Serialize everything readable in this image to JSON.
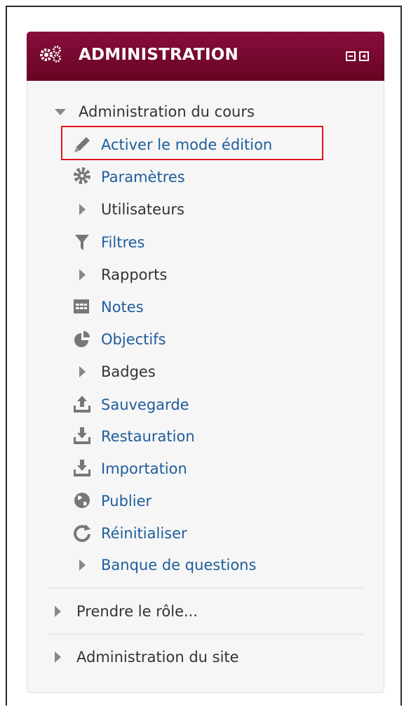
{
  "block": {
    "title": "ADMINISTRATION",
    "header_color": "#7a0a33",
    "link_color": "#1e5d9c"
  },
  "course_admin": {
    "label": "Administration du cours",
    "items": [
      {
        "label": "Activer le mode édition",
        "icon": "pencil-icon"
      },
      {
        "label": "Paramètres",
        "icon": "gear-icon"
      },
      {
        "label": "Utilisateurs",
        "icon": "expand-arrow-icon"
      },
      {
        "label": "Filtres",
        "icon": "filter-icon"
      },
      {
        "label": "Rapports",
        "icon": "expand-arrow-icon"
      },
      {
        "label": "Notes",
        "icon": "table-icon"
      },
      {
        "label": "Objectifs",
        "icon": "pie-chart-icon"
      },
      {
        "label": "Badges",
        "icon": "expand-arrow-icon"
      },
      {
        "label": "Sauvegarde",
        "icon": "upload-icon"
      },
      {
        "label": "Restauration",
        "icon": "download-icon"
      },
      {
        "label": "Importation",
        "icon": "download-icon"
      },
      {
        "label": "Publier",
        "icon": "globe-icon"
      },
      {
        "label": "Réinitialiser",
        "icon": "refresh-icon"
      },
      {
        "label": "Banque de questions",
        "icon": "expand-arrow-icon"
      }
    ]
  },
  "other_sections": [
    {
      "label": "Prendre le rôle..."
    },
    {
      "label": "Administration du site"
    }
  ]
}
